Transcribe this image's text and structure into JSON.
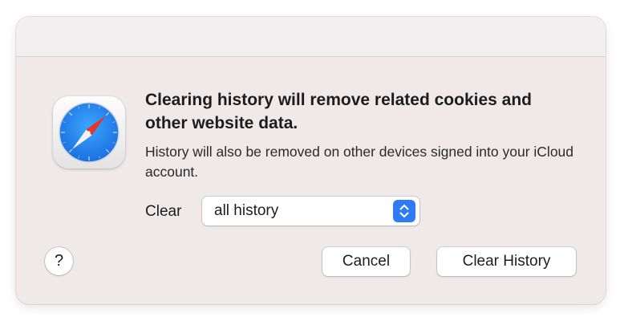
{
  "dialog": {
    "headline": "Clearing history will remove related cookies and other website data.",
    "message": "History will also be removed on other devices signed into your iCloud account.",
    "clear_label": "Clear",
    "clear_range": {
      "selected": "all history"
    },
    "help_label": "?",
    "cancel_label": "Cancel",
    "confirm_label": "Clear History",
    "app_icon": "safari-compass-icon",
    "colors": {
      "dialog_bg": "#efe9ea",
      "accent": "#2f7bf6",
      "compass_red": "#e8352b",
      "text": "#1d1d1f"
    }
  }
}
